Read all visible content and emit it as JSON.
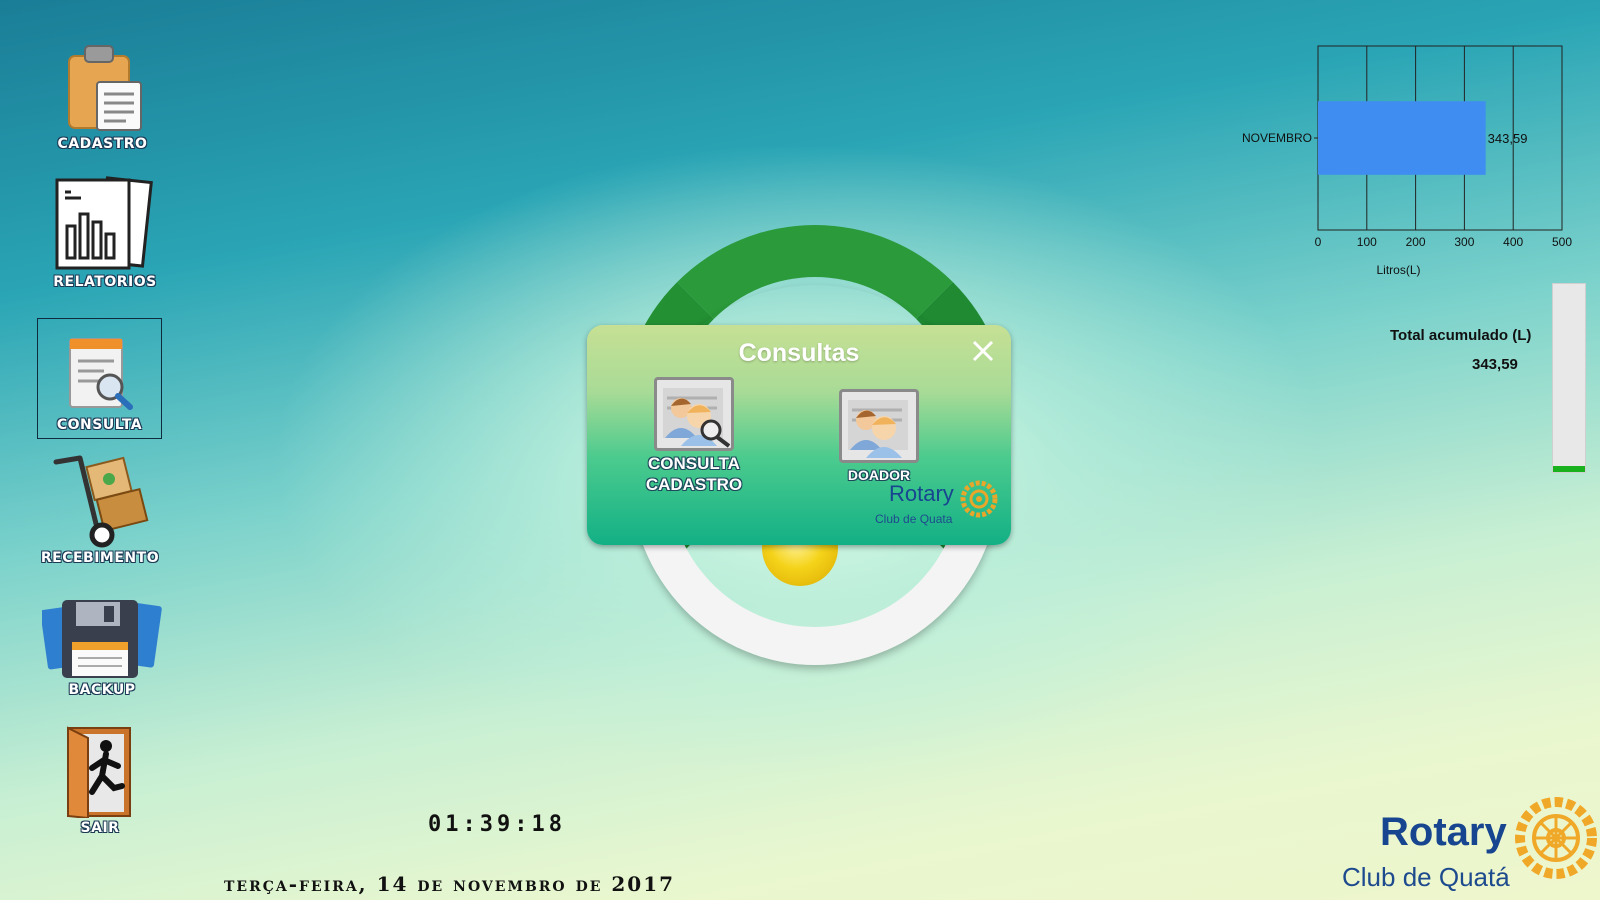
{
  "sidebar": {
    "items": [
      {
        "label": "CADASTRO"
      },
      {
        "label": "RELATORIOS"
      },
      {
        "label": "CONSULTA"
      },
      {
        "label": "RECEBIMENTO"
      },
      {
        "label": "BACKUP"
      },
      {
        "label": "SAIR"
      }
    ]
  },
  "modal": {
    "title": "Consultas",
    "options": [
      {
        "label_line1": "CONSULTA",
        "label_line2": "CADASTRO"
      },
      {
        "label": "DOADOR"
      }
    ],
    "brand": {
      "name": "Rotary",
      "subtitle": "Club de Quata"
    }
  },
  "clock": "01:39:18",
  "date": "terça-feira, 14 de novembro de 2017",
  "totals": {
    "label": "Total acumulado (L)",
    "value": "343,59",
    "progress_fraction": 0.03
  },
  "footer_brand": {
    "name": "Rotary",
    "subtitle": "Club de Quatá"
  },
  "chart_data": {
    "type": "bar",
    "orientation": "horizontal",
    "categories": [
      "NOVEMBRO"
    ],
    "values": [
      343.59
    ],
    "value_labels": [
      "343,59"
    ],
    "xlabel": "Litros(L)",
    "xlim": [
      0,
      500
    ],
    "xticks": [
      "0",
      "100",
      "200",
      "300",
      "400",
      "500"
    ],
    "grid": true,
    "bar_color": "#3f8df0"
  }
}
